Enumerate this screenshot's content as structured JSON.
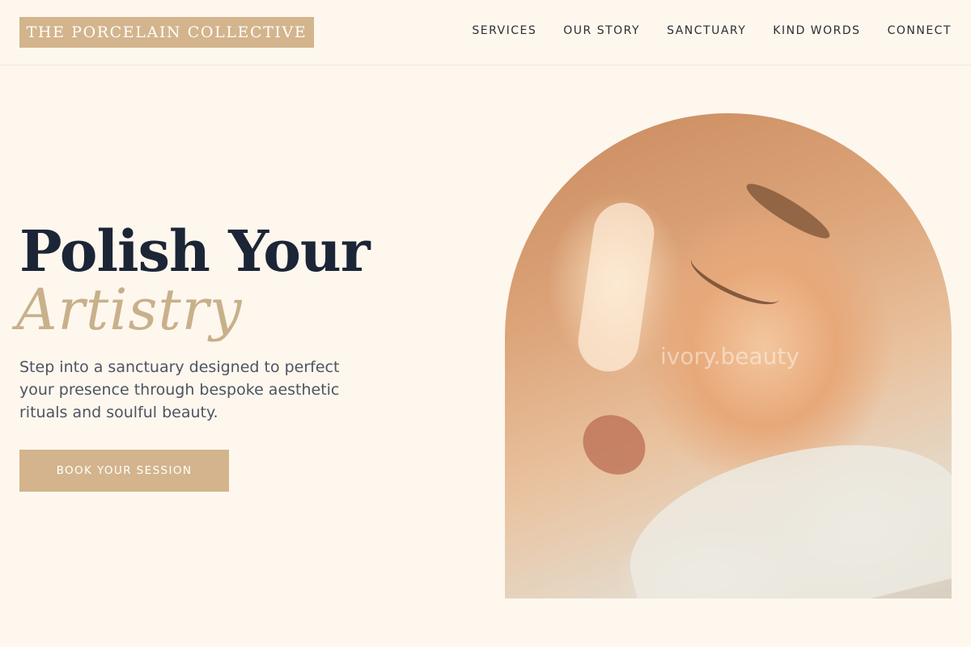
{
  "brand": {
    "name": "THE PORCELAIN COLLECTIVE"
  },
  "nav": {
    "items": [
      {
        "label": "SERVICES"
      },
      {
        "label": "OUR STORY"
      },
      {
        "label": "SANCTUARY"
      },
      {
        "label": "KIND WORDS"
      },
      {
        "label": "CONNECT"
      }
    ]
  },
  "hero": {
    "title": "Polish Your",
    "accent": "Artistry",
    "description": "Step into a sanctuary designed to perfect your presence through bespoke aesthetic rituals and soulful beauty.",
    "cta_label": "BOOK YOUR SESSION",
    "image": {
      "watermark": "ivory.beauty",
      "subject": "woman with eyes closed in warm light"
    }
  },
  "colors": {
    "background": "#fdf7ee",
    "accent": "#d3b48c",
    "heading": "#1c2536",
    "script": "#c8b08b"
  }
}
